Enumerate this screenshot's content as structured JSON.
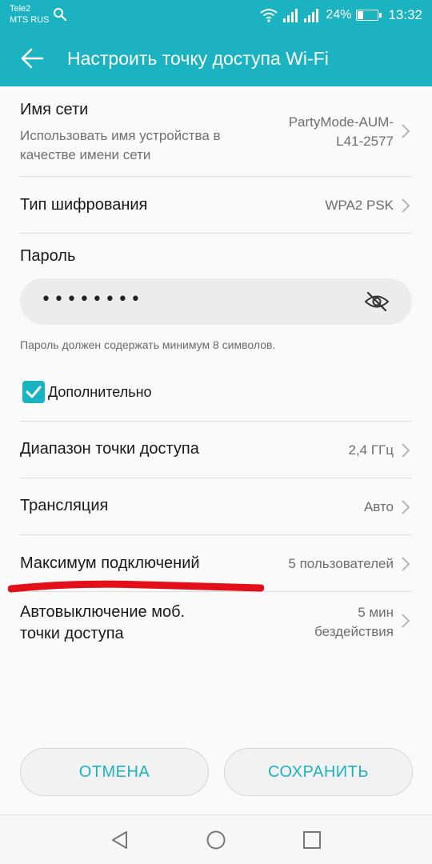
{
  "status_bar": {
    "carrier_1": "Tele2",
    "carrier_2": "MTS RUS",
    "battery_pct": "24%",
    "battery_level": 0.24,
    "time": "13:32",
    "icons": [
      "search-icon",
      "wifi-icon",
      "signal-icon",
      "signal-icon",
      "battery-icon"
    ]
  },
  "header": {
    "title": "Настроить точку доступа Wi-Fi",
    "back_icon": "arrow-left-icon"
  },
  "network_name": {
    "label": "Имя сети",
    "subtitle": "Использовать имя устройства в качестве имени сети",
    "subtitle_line1": "Использовать имя устройства в",
    "subtitle_line2": "качестве имени сети",
    "value": "PartyMode-AUM-L41-2577",
    "value_line1": "PartyMode-AUM-",
    "value_line2": "L41-2577"
  },
  "encryption": {
    "label": "Тип шифрования",
    "value": "WPA2 PSK"
  },
  "password": {
    "label": "Пароль",
    "value": "••••••••",
    "hint": "Пароль должен содержать минимум 8 символов.",
    "toggle_icon": "eye-off-icon"
  },
  "advanced": {
    "label": "Дополнительно",
    "checked": true
  },
  "band": {
    "label": "Диапазон точки доступа",
    "value": "2,4 ГГц"
  },
  "broadcast": {
    "label": "Трансляция",
    "value": "Авто"
  },
  "max_connections": {
    "label": "Максимум подключений",
    "value": "5 пользователей"
  },
  "auto_off": {
    "label_line1": "Автовыключение моб.",
    "label_line2": "точки доступа",
    "value_line1": "5 мин",
    "value_line2": "бездействия"
  },
  "buttons": {
    "cancel": "ОТМЕНА",
    "save": "СОХРАНИТЬ"
  },
  "nav": [
    "back-triangle-icon",
    "home-circle-icon",
    "recents-square-icon"
  ],
  "colors": {
    "accent": "#1bb3c2",
    "annotation_red": "#e3101a"
  }
}
